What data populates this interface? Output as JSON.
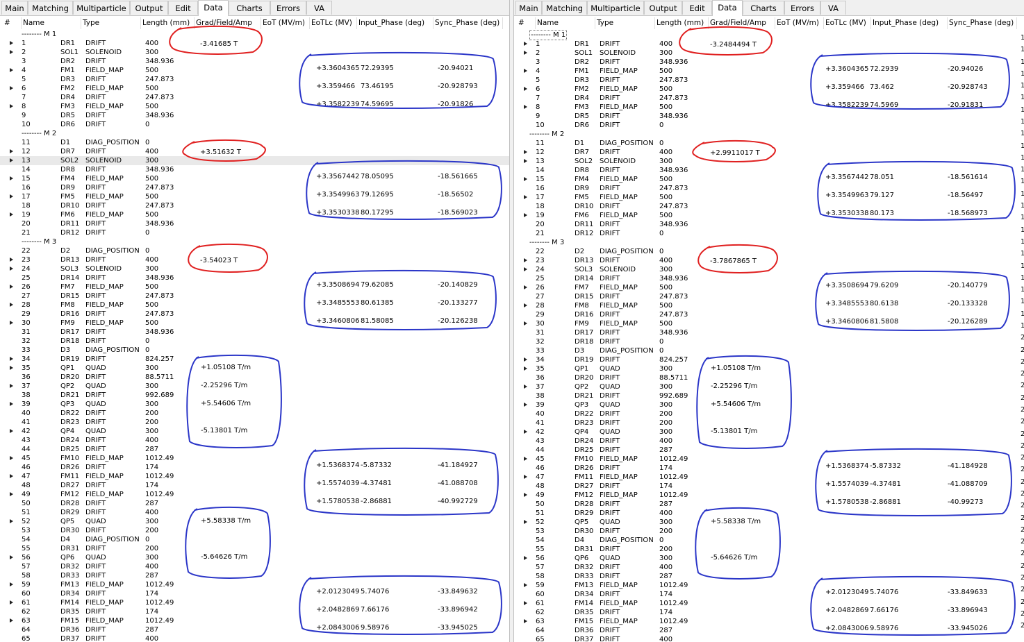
{
  "tabs": [
    "Main",
    "Matching",
    "Multiparticle",
    "Output",
    "Edit",
    "Data",
    "Charts",
    "Errors",
    "VA"
  ],
  "active_tab": "Data",
  "columns": [
    "#",
    "Name",
    "Type",
    "Length (mm)",
    "Grad/Field/Amp",
    "EoT (MV/m)",
    "EoTLc (MV)",
    "Input_Phase (deg)",
    "Sync_Phase (deg)"
  ],
  "rows": [
    {
      "k": "g",
      "label": "-------- M 1"
    },
    {
      "k": "r",
      "n": "1",
      "name": "DR1",
      "type": "DRIFT",
      "len": "400",
      "arrow": 1
    },
    {
      "k": "r",
      "n": "2",
      "name": "SOL1",
      "type": "SOLENOID",
      "len": "300",
      "arrow": 1
    },
    {
      "k": "r",
      "n": "3",
      "name": "DR2",
      "type": "DRIFT",
      "len": "348.936"
    },
    {
      "k": "r",
      "n": "4",
      "name": "FM1",
      "type": "FIELD_MAP",
      "len": "500",
      "arrow": 1
    },
    {
      "k": "r",
      "n": "5",
      "name": "DR3",
      "type": "DRIFT",
      "len": "247.873"
    },
    {
      "k": "r",
      "n": "6",
      "name": "FM2",
      "type": "FIELD_MAP",
      "len": "500",
      "arrow": 1
    },
    {
      "k": "r",
      "n": "7",
      "name": "DR4",
      "type": "DRIFT",
      "len": "247.873"
    },
    {
      "k": "r",
      "n": "8",
      "name": "FM3",
      "type": "FIELD_MAP",
      "len": "500",
      "arrow": 1
    },
    {
      "k": "r",
      "n": "9",
      "name": "DR5",
      "type": "DRIFT",
      "len": "348.936"
    },
    {
      "k": "r",
      "n": "10",
      "name": "DR6",
      "type": "DRIFT",
      "len": "0"
    },
    {
      "k": "g",
      "label": "-------- M 2"
    },
    {
      "k": "r",
      "n": "11",
      "name": "D1",
      "type": "DIAG_POSITION",
      "len": "0"
    },
    {
      "k": "r",
      "n": "12",
      "name": "DR7",
      "type": "DRIFT",
      "len": "400",
      "arrow": 1
    },
    {
      "k": "r",
      "n": "13",
      "name": "SOL2",
      "type": "SOLENOID",
      "len": "300",
      "arrow": 1,
      "sel": 1
    },
    {
      "k": "r",
      "n": "14",
      "name": "DR8",
      "type": "DRIFT",
      "len": "348.936"
    },
    {
      "k": "r",
      "n": "15",
      "name": "FM4",
      "type": "FIELD_MAP",
      "len": "500",
      "arrow": 1
    },
    {
      "k": "r",
      "n": "16",
      "name": "DR9",
      "type": "DRIFT",
      "len": "247.873"
    },
    {
      "k": "r",
      "n": "17",
      "name": "FM5",
      "type": "FIELD_MAP",
      "len": "500",
      "arrow": 1
    },
    {
      "k": "r",
      "n": "18",
      "name": "DR10",
      "type": "DRIFT",
      "len": "247.873"
    },
    {
      "k": "r",
      "n": "19",
      "name": "FM6",
      "type": "FIELD_MAP",
      "len": "500",
      "arrow": 1
    },
    {
      "k": "r",
      "n": "20",
      "name": "DR11",
      "type": "DRIFT",
      "len": "348.936"
    },
    {
      "k": "r",
      "n": "21",
      "name": "DR12",
      "type": "DRIFT",
      "len": "0"
    },
    {
      "k": "g",
      "label": "-------- M 3"
    },
    {
      "k": "r",
      "n": "22",
      "name": "D2",
      "type": "DIAG_POSITION",
      "len": "0"
    },
    {
      "k": "r",
      "n": "23",
      "name": "DR13",
      "type": "DRIFT",
      "len": "400",
      "arrow": 1
    },
    {
      "k": "r",
      "n": "24",
      "name": "SOL3",
      "type": "SOLENOID",
      "len": "300",
      "arrow": 1
    },
    {
      "k": "r",
      "n": "25",
      "name": "DR14",
      "type": "DRIFT",
      "len": "348.936"
    },
    {
      "k": "r",
      "n": "26",
      "name": "FM7",
      "type": "FIELD_MAP",
      "len": "500",
      "arrow": 1
    },
    {
      "k": "r",
      "n": "27",
      "name": "DR15",
      "type": "DRIFT",
      "len": "247.873"
    },
    {
      "k": "r",
      "n": "28",
      "name": "FM8",
      "type": "FIELD_MAP",
      "len": "500",
      "arrow": 1
    },
    {
      "k": "r",
      "n": "29",
      "name": "DR16",
      "type": "DRIFT",
      "len": "247.873"
    },
    {
      "k": "r",
      "n": "30",
      "name": "FM9",
      "type": "FIELD_MAP",
      "len": "500",
      "arrow": 1
    },
    {
      "k": "r",
      "n": "31",
      "name": "DR17",
      "type": "DRIFT",
      "len": "348.936"
    },
    {
      "k": "r",
      "n": "32",
      "name": "DR18",
      "type": "DRIFT",
      "len": "0"
    },
    {
      "k": "r",
      "n": "33",
      "name": "D3",
      "type": "DIAG_POSITION",
      "len": "0"
    },
    {
      "k": "r",
      "n": "34",
      "name": "DR19",
      "type": "DRIFT",
      "len": "824.257",
      "arrow": 1
    },
    {
      "k": "r",
      "n": "35",
      "name": "QP1",
      "type": "QUAD",
      "len": "300",
      "arrow": 1
    },
    {
      "k": "r",
      "n": "36",
      "name": "DR20",
      "type": "DRIFT",
      "len": "88.5711"
    },
    {
      "k": "r",
      "n": "37",
      "name": "QP2",
      "type": "QUAD",
      "len": "300",
      "arrow": 1
    },
    {
      "k": "r",
      "n": "38",
      "name": "DR21",
      "type": "DRIFT",
      "len": "992.689"
    },
    {
      "k": "r",
      "n": "39",
      "name": "QP3",
      "type": "QUAD",
      "len": "300",
      "arrow": 1
    },
    {
      "k": "r",
      "n": "40",
      "name": "DR22",
      "type": "DRIFT",
      "len": "200"
    },
    {
      "k": "r",
      "n": "41",
      "name": "DR23",
      "type": "DRIFT",
      "len": "200"
    },
    {
      "k": "r",
      "n": "42",
      "name": "QP4",
      "type": "QUAD",
      "len": "300",
      "arrow": 1
    },
    {
      "k": "r",
      "n": "43",
      "name": "DR24",
      "type": "DRIFT",
      "len": "400"
    },
    {
      "k": "r",
      "n": "44",
      "name": "DR25",
      "type": "DRIFT",
      "len": "287"
    },
    {
      "k": "r",
      "n": "45",
      "name": "FM10",
      "type": "FIELD_MAP",
      "len": "1012.49",
      "arrow": 1
    },
    {
      "k": "r",
      "n": "46",
      "name": "DR26",
      "type": "DRIFT",
      "len": "174"
    },
    {
      "k": "r",
      "n": "47",
      "name": "FM11",
      "type": "FIELD_MAP",
      "len": "1012.49",
      "arrow": 1
    },
    {
      "k": "r",
      "n": "48",
      "name": "DR27",
      "type": "DRIFT",
      "len": "174"
    },
    {
      "k": "r",
      "n": "49",
      "name": "FM12",
      "type": "FIELD_MAP",
      "len": "1012.49",
      "arrow": 1
    },
    {
      "k": "r",
      "n": "50",
      "name": "DR28",
      "type": "DRIFT",
      "len": "287"
    },
    {
      "k": "r",
      "n": "51",
      "name": "DR29",
      "type": "DRIFT",
      "len": "400"
    },
    {
      "k": "r",
      "n": "52",
      "name": "QP5",
      "type": "QUAD",
      "len": "300",
      "arrow": 1
    },
    {
      "k": "r",
      "n": "53",
      "name": "DR30",
      "type": "DRIFT",
      "len": "200"
    },
    {
      "k": "r",
      "n": "54",
      "name": "D4",
      "type": "DIAG_POSITION",
      "len": "0"
    },
    {
      "k": "r",
      "n": "55",
      "name": "DR31",
      "type": "DRIFT",
      "len": "200"
    },
    {
      "k": "r",
      "n": "56",
      "name": "QP6",
      "type": "QUAD",
      "len": "300",
      "arrow": 1
    },
    {
      "k": "r",
      "n": "57",
      "name": "DR32",
      "type": "DRIFT",
      "len": "400"
    },
    {
      "k": "r",
      "n": "58",
      "name": "DR33",
      "type": "DRIFT",
      "len": "287"
    },
    {
      "k": "r",
      "n": "59",
      "name": "FM13",
      "type": "FIELD_MAP",
      "len": "1012.49",
      "arrow": 1
    },
    {
      "k": "r",
      "n": "60",
      "name": "DR34",
      "type": "DRIFT",
      "len": "174"
    },
    {
      "k": "r",
      "n": "61",
      "name": "FM14",
      "type": "FIELD_MAP",
      "len": "1012.49",
      "arrow": 1
    },
    {
      "k": "r",
      "n": "62",
      "name": "DR35",
      "type": "DRIFT",
      "len": "174"
    },
    {
      "k": "r",
      "n": "63",
      "name": "FM15",
      "type": "FIELD_MAP",
      "len": "1012.49",
      "arrow": 1
    },
    {
      "k": "r",
      "n": "64",
      "name": "DR36",
      "type": "DRIFT",
      "len": "287"
    },
    {
      "k": "r",
      "n": "65",
      "name": "DR37",
      "type": "DRIFT",
      "len": "400"
    }
  ],
  "left": {
    "sol": [
      {
        "row": 2,
        "value": "-3.41685 T"
      },
      {
        "row": 14,
        "value": "+3.51632 T"
      },
      {
        "row": 26,
        "value": "-3.54023 T"
      }
    ],
    "fm": [
      {
        "row": 4,
        "eotlc": "+3.3604365",
        "input": "72.29395",
        "sync": "-20.94021"
      },
      {
        "row": 6,
        "eotlc": "+3.359466",
        "input": "73.46195",
        "sync": "-20.928793"
      },
      {
        "row": 8,
        "eotlc": "+3.3582239",
        "input": "74.59695",
        "sync": "-20.91826"
      },
      {
        "row": 16,
        "eotlc": "+3.3567442",
        "input": "78.05095",
        "sync": "-18.561665"
      },
      {
        "row": 18,
        "eotlc": "+3.3549963",
        "input": "79.12695",
        "sync": "-18.56502"
      },
      {
        "row": 20,
        "eotlc": "+3.3530338",
        "input": "80.17295",
        "sync": "-18.569023"
      },
      {
        "row": 28,
        "eotlc": "+3.3508694",
        "input": "79.62085",
        "sync": "-20.140829"
      },
      {
        "row": 30,
        "eotlc": "+3.3485553",
        "input": "80.61385",
        "sync": "-20.133277"
      },
      {
        "row": 32,
        "eotlc": "+3.3460806",
        "input": "81.58085",
        "sync": "-20.126238"
      },
      {
        "row": 48,
        "eotlc": "+1.5368374",
        "input": "-5.87332",
        "sync": "-41.184927"
      },
      {
        "row": 50,
        "eotlc": "+1.5574039",
        "input": "-4.37481",
        "sync": "-41.088708"
      },
      {
        "row": 52,
        "eotlc": "+1.5780538",
        "input": "-2.86881",
        "sync": "-40.992729"
      },
      {
        "row": 62,
        "eotlc": "+2.0123049",
        "input": "5.74076",
        "sync": "-33.849632"
      },
      {
        "row": 64,
        "eotlc": "+2.0482869",
        "input": "7.66176",
        "sync": "-33.896942"
      },
      {
        "row": 66,
        "eotlc": "+2.0843006",
        "input": "9.58976",
        "sync": "-33.945025"
      }
    ],
    "quad": [
      {
        "row": 38,
        "value": "+1.05108 T/m"
      },
      {
        "row": 40,
        "value": "-2.25296 T/m"
      },
      {
        "row": 42,
        "value": "+5.54606 T/m"
      },
      {
        "row": 45,
        "value": "-5.13801 T/m"
      },
      {
        "row": 55,
        "value": "+5.58338 T/m"
      },
      {
        "row": 59,
        "value": "-5.64626 T/m"
      }
    ]
  },
  "right": {
    "sol": [
      {
        "row": 2,
        "value": "-3.2484494 T"
      },
      {
        "row": 14,
        "value": "+2.9911017 T"
      },
      {
        "row": 26,
        "value": "-3.7867865 T"
      }
    ],
    "fm": [
      {
        "row": 4,
        "eotlc": "+3.3604365",
        "input": "72.2939",
        "sync": "-20.94026"
      },
      {
        "row": 6,
        "eotlc": "+3.359466",
        "input": "73.462",
        "sync": "-20.928743"
      },
      {
        "row": 8,
        "eotlc": "+3.3582239",
        "input": "74.5969",
        "sync": "-20.91831"
      },
      {
        "row": 16,
        "eotlc": "+3.3567442",
        "input": "78.051",
        "sync": "-18.561614"
      },
      {
        "row": 18,
        "eotlc": "+3.3549963",
        "input": "79.127",
        "sync": "-18.56497"
      },
      {
        "row": 20,
        "eotlc": "+3.3530338",
        "input": "80.173",
        "sync": "-18.568973"
      },
      {
        "row": 28,
        "eotlc": "+3.3508694",
        "input": "79.6209",
        "sync": "-20.140779"
      },
      {
        "row": 30,
        "eotlc": "+3.3485553",
        "input": "80.6138",
        "sync": "-20.133328"
      },
      {
        "row": 32,
        "eotlc": "+3.3460806",
        "input": "81.5808",
        "sync": "-20.126289"
      },
      {
        "row": 48,
        "eotlc": "+1.5368374",
        "input": "-5.87332",
        "sync": "-41.184928"
      },
      {
        "row": 50,
        "eotlc": "+1.5574039",
        "input": "-4.37481",
        "sync": "-41.088709"
      },
      {
        "row": 52,
        "eotlc": "+1.5780538",
        "input": "-2.86881",
        "sync": "-40.99273"
      },
      {
        "row": 62,
        "eotlc": "+2.0123049",
        "input": "5.74076",
        "sync": "-33.849633"
      },
      {
        "row": 64,
        "eotlc": "+2.0482869",
        "input": "7.66176",
        "sync": "-33.896943"
      },
      {
        "row": 66,
        "eotlc": "+2.0843006",
        "input": "9.58976",
        "sync": "-33.945026"
      }
    ],
    "quad": [
      {
        "row": 38,
        "value": "+1.05108 T/m"
      },
      {
        "row": 40,
        "value": "-2.25296 T/m"
      },
      {
        "row": 42,
        "value": "+5.54606 T/m"
      },
      {
        "row": 45,
        "value": "-5.13801 T/m"
      },
      {
        "row": 55,
        "value": "+5.58338 T/m"
      },
      {
        "row": 59,
        "value": "-5.64626 T/m"
      }
    ],
    "edge_digits": [
      "1",
      "1",
      "1",
      "1",
      "1",
      "1",
      "1",
      "1",
      "1",
      "1",
      "1",
      "1",
      "1",
      "1",
      "1",
      "1",
      "1",
      "1",
      "1",
      "1",
      "1",
      "1",
      "1",
      "1",
      "1",
      "2",
      "2",
      "2",
      "2",
      "2",
      "2",
      "2",
      "2",
      "2",
      "2",
      "2",
      "2",
      "2",
      "2",
      "2",
      "2",
      "2",
      "2",
      "2",
      "2",
      "2",
      "2",
      "2",
      "2",
      "2"
    ]
  },
  "colors": {
    "red_annotation": "#e02020",
    "blue_annotation": "#2b36c8",
    "selected_row": "#e9e9e9"
  }
}
